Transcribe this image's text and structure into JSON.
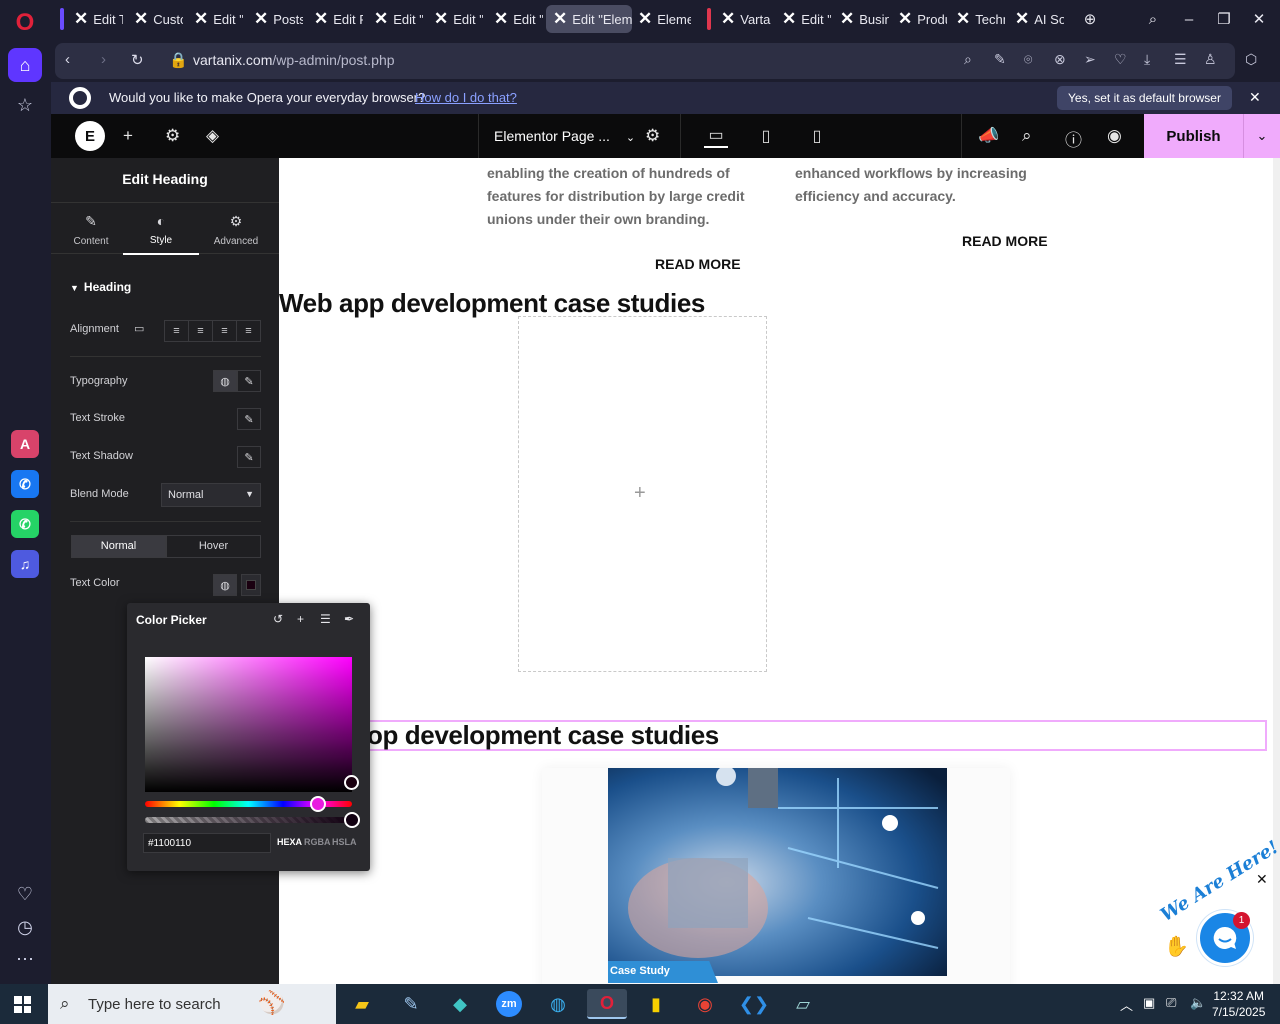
{
  "browser": {
    "tabs": [
      {
        "label": "Edit T",
        "icon": "x-logo"
      },
      {
        "label": "Custo",
        "icon": "x-logo"
      },
      {
        "label": "Edit \"",
        "icon": "x-logo"
      },
      {
        "label": "Posts",
        "icon": "x-logo"
      },
      {
        "label": "Edit P",
        "icon": "x-logo"
      },
      {
        "label": "Edit \"",
        "icon": "x-logo"
      },
      {
        "label": "Edit \"",
        "icon": "x-logo"
      },
      {
        "label": "Edit \"",
        "icon": "x-logo"
      },
      {
        "label": "Edit \"Eleme",
        "icon": "x-logo",
        "active": true
      },
      {
        "label": "Eleme",
        "icon": "x-logo"
      },
      {
        "label": "Varta",
        "icon": "x-logo"
      },
      {
        "label": "Edit \"",
        "icon": "x-logo"
      },
      {
        "label": "Busin",
        "icon": "x-logo"
      },
      {
        "label": "Produ",
        "icon": "x-logo"
      },
      {
        "label": "Techn",
        "icon": "x-logo"
      },
      {
        "label": "AI So",
        "icon": "x-logo"
      }
    ],
    "url": {
      "host": "vartanix.com",
      "path": "/wp-admin/post.php"
    },
    "default_prompt": {
      "message": "Would you like to make Opera your everyday browser?",
      "link": "How do I do that?",
      "button": "Yes, set it as default browser"
    }
  },
  "elementor": {
    "page_selector": "Elementor Page ...",
    "publish_label": "Publish",
    "accent_color": "#f0abfc"
  },
  "panel": {
    "title": "Edit Heading",
    "tabs": [
      {
        "label": "Content",
        "icon": "pencil-icon"
      },
      {
        "label": "Style",
        "icon": "contrast-icon",
        "active": true
      },
      {
        "label": "Advanced",
        "icon": "gear-icon"
      }
    ],
    "section": "Heading",
    "alignment_label": "Alignment",
    "typography_label": "Typography",
    "text_stroke_label": "Text Stroke",
    "text_shadow_label": "Text Shadow",
    "blend_mode_label": "Blend Mode",
    "blend_mode_value": "Normal",
    "state_normal": "Normal",
    "state_hover": "Hover",
    "text_color_label": "Text Color"
  },
  "color_picker": {
    "title": "Color Picker",
    "hex_value": "#1100110",
    "formats": [
      "HEXA",
      "RGBA",
      "HSLA"
    ],
    "active_format": "HEXA",
    "hue_color": "#ff00ff"
  },
  "canvas": {
    "card_left_text": [
      "enabling the creation of hundreds of",
      "features for distribution by large credit",
      "unions under their own branding."
    ],
    "card_right_text": [
      "enhanced workflows by increasing",
      "efficiency and accuracy."
    ],
    "read_more": "READ MORE",
    "heading_web": "Web app development case studies",
    "heading_app": "op development case studies",
    "case_study_badge": "Case Study",
    "chat_label": "We Are Here!",
    "chat_badge_count": "1"
  },
  "taskbar": {
    "search_placeholder": "Type here to search",
    "time": "12:32 AM",
    "date": "7/15/2025"
  }
}
